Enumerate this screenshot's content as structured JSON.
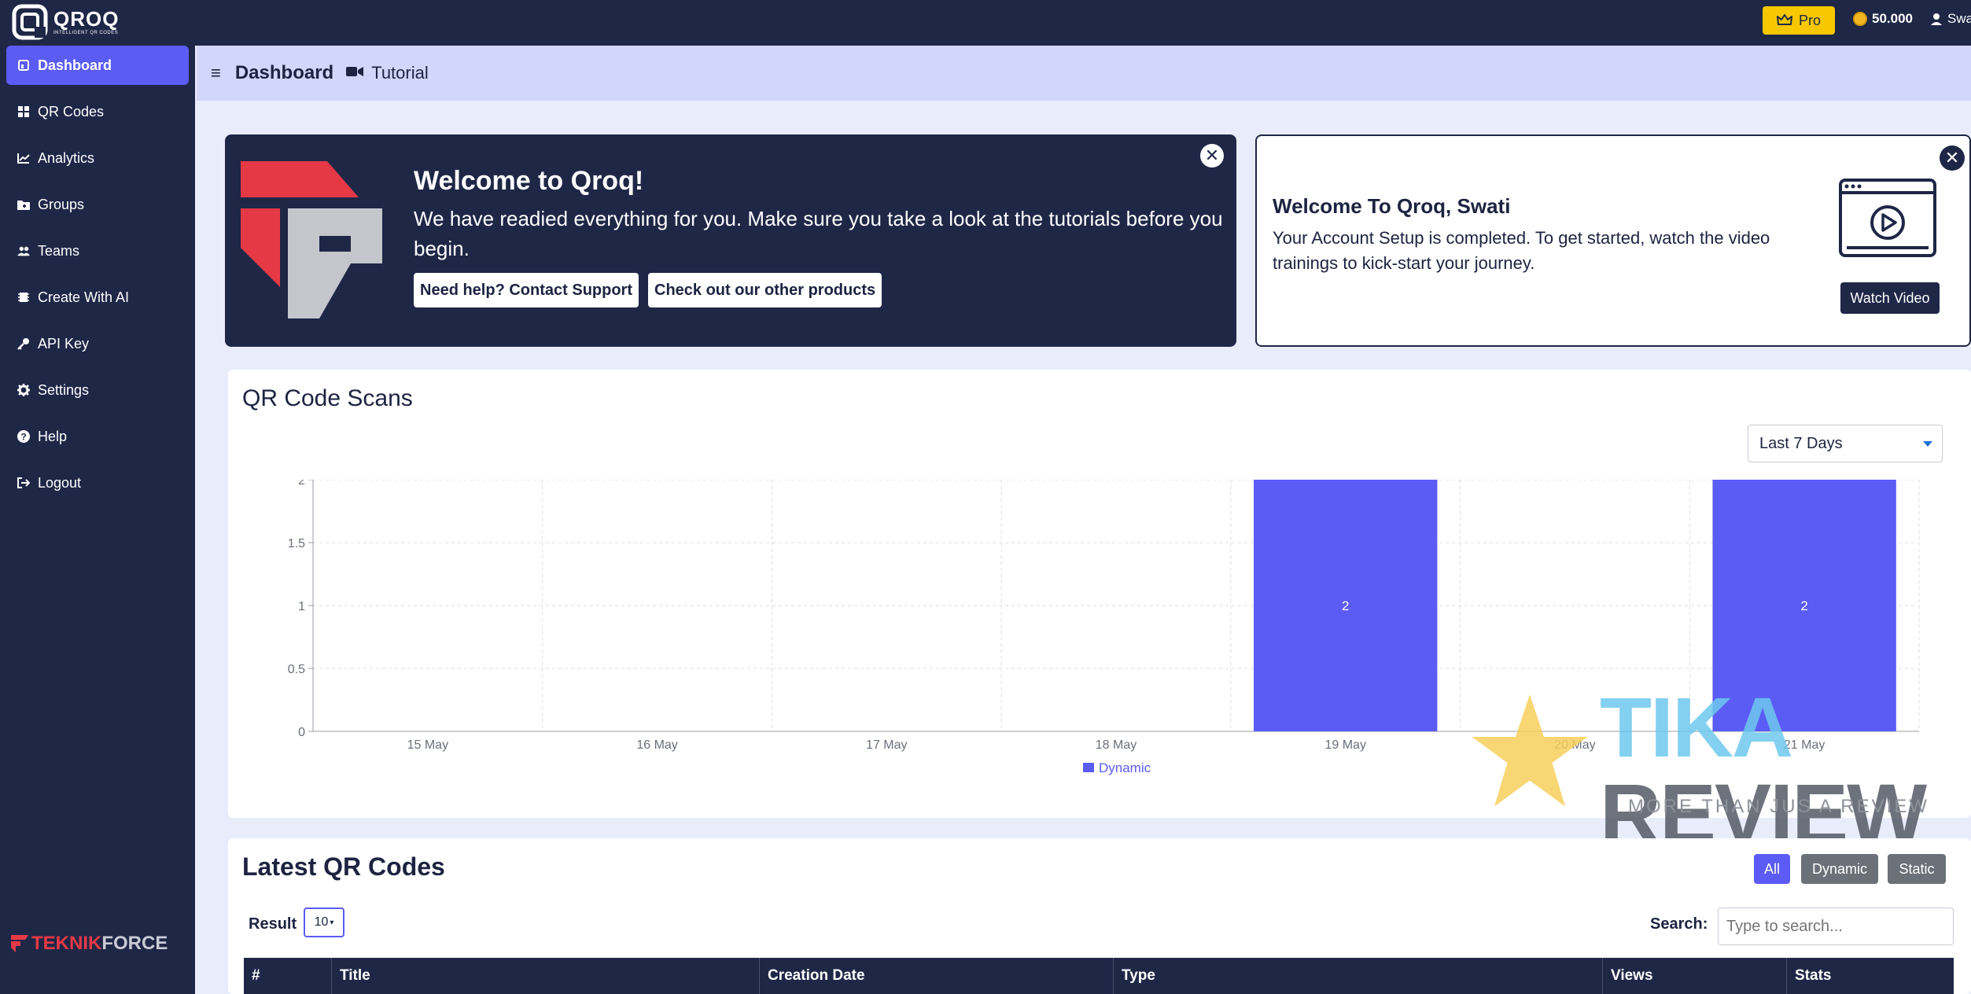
{
  "app": {
    "logo_text": "QROQ",
    "logo_sub": "INTELLIGENT QR CODES",
    "pro_label": "Pro",
    "credits": "50.000",
    "user_name": "Swati"
  },
  "sidebar": {
    "items": [
      {
        "label": "Dashboard",
        "icon": "dashboard-icon"
      },
      {
        "label": "QR Codes",
        "icon": "qr-grid-icon"
      },
      {
        "label": "Analytics",
        "icon": "chart-icon"
      },
      {
        "label": "Groups",
        "icon": "folder-icon"
      },
      {
        "label": "Teams",
        "icon": "users-icon"
      },
      {
        "label": "Create With AI",
        "icon": "chip-icon"
      },
      {
        "label": "API Key",
        "icon": "key-icon"
      },
      {
        "label": "Settings",
        "icon": "gear-icon"
      },
      {
        "label": "Help",
        "icon": "question-icon"
      },
      {
        "label": "Logout",
        "icon": "logout-icon"
      }
    ],
    "footer_brand_red": "TEKNIK",
    "footer_brand_white": "FORCE"
  },
  "header": {
    "title": "Dashboard",
    "tutorial_label": "Tutorial"
  },
  "welcome": {
    "title": "Welcome to Qroq!",
    "text": "We have readied everything for you. Make sure you take a look at the tutorials before you begin.",
    "support_btn": "Need help? Contact Support",
    "products_btn": "Check out our other products"
  },
  "welcome2": {
    "title": "Welcome To Qroq, Swati",
    "text": "Your Account Setup is completed. To get started, watch the video trainings to kick-start your journey.",
    "watch_btn": "Watch Video"
  },
  "scans": {
    "title": "QR Code Scans",
    "range_selected": "Last 7 Days"
  },
  "chart_data": {
    "type": "bar",
    "categories": [
      "15 May",
      "16 May",
      "17 May",
      "18 May",
      "19 May",
      "20 May",
      "21 May"
    ],
    "series": [
      {
        "name": "Dynamic",
        "values": [
          0,
          0,
          0,
          0,
          2,
          0,
          2
        ],
        "color": "#5b5bf6"
      }
    ],
    "ylim": [
      0,
      2
    ],
    "yticks": [
      "0",
      "0.5",
      "1",
      "1.5",
      "2"
    ],
    "data_labels": [
      "",
      "",
      "",
      "",
      "2",
      "",
      "2"
    ],
    "grid": true,
    "legend": "bottom-center"
  },
  "watermark": {
    "title_a": "TIKA",
    "title_b": "REVIEW",
    "subtitle": "MORE THAN JUS A REVIEW"
  },
  "latest": {
    "title": "Latest QR Codes",
    "filters": [
      "All",
      "Dynamic",
      "Static"
    ],
    "result_label": "Result",
    "result_value": "10",
    "search_label": "Search:",
    "search_placeholder": "Type to search...",
    "columns": [
      "#",
      "Title",
      "Creation Date",
      "Type",
      "Views",
      "Stats"
    ]
  },
  "colors": {
    "navy": "#1f2747",
    "accent": "#5b5bf6",
    "pro": "#f7c800",
    "brand_red": "#e63946"
  }
}
